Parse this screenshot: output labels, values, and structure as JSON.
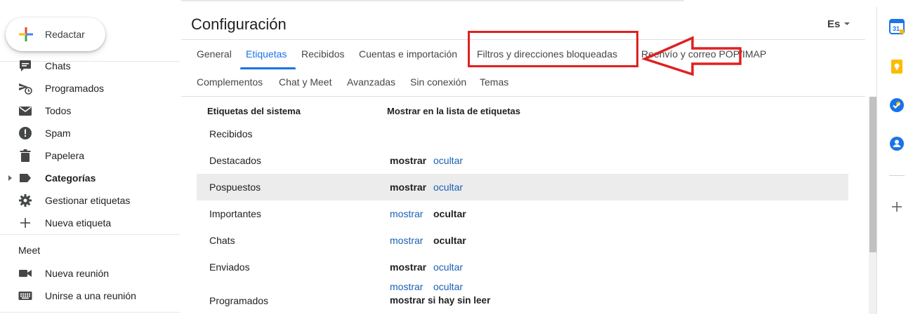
{
  "compose": {
    "label": "Redactar"
  },
  "sidebar": {
    "items": [
      {
        "label": "Chats",
        "icon": "chat-icon",
        "bold": false
      },
      {
        "label": "Programados",
        "icon": "scheduled-icon",
        "bold": false
      },
      {
        "label": "Todos",
        "icon": "all-mail-icon",
        "bold": false
      },
      {
        "label": "Spam",
        "icon": "spam-icon",
        "bold": false
      },
      {
        "label": "Papelera",
        "icon": "trash-icon",
        "bold": false
      },
      {
        "label": "Categorías",
        "icon": "label-icon",
        "bold": true
      },
      {
        "label": "Gestionar etiquetas",
        "icon": "gear-icon",
        "bold": false
      },
      {
        "label": "Nueva etiqueta",
        "icon": "plus-icon",
        "bold": false
      }
    ],
    "meet": {
      "title": "Meet",
      "items": [
        {
          "label": "Nueva reunión",
          "icon": "video-camera-icon"
        },
        {
          "label": "Unirse a una reunión",
          "icon": "keyboard-icon"
        }
      ]
    }
  },
  "header": {
    "title": "Configuración",
    "language": "Es"
  },
  "tabs": {
    "row1": [
      "General",
      "Etiquetas",
      "Recibidos",
      "Cuentas e importación",
      "Filtros y direcciones bloqueadas",
      "Reenvío y correo POP/IMAP"
    ],
    "row2": [
      "Complementos",
      "Chat y Meet",
      "Avanzadas",
      "Sin conexión",
      "Temas"
    ],
    "active": "Etiquetas"
  },
  "labels_table": {
    "col_system": "Etiquetas del sistema",
    "col_show": "Mostrar en la lista de etiquetas",
    "rows": [
      {
        "name": "Recibidos"
      },
      {
        "name": "Destacados",
        "show": "mostrar",
        "hide": "ocultar",
        "selected": "mostrar"
      },
      {
        "name": "Pospuestos",
        "show": "mostrar",
        "hide": "ocultar",
        "selected": "mostrar"
      },
      {
        "name": "Importantes",
        "show": "mostrar",
        "hide": "ocultar",
        "selected": "ocultar"
      },
      {
        "name": "Chats",
        "show": "mostrar",
        "hide": "ocultar",
        "selected": "ocultar"
      },
      {
        "name": "Enviados",
        "show": "mostrar",
        "hide": "ocultar",
        "selected": "mostrar"
      },
      {
        "name": "Programados",
        "show": "mostrar",
        "hide": "ocultar",
        "selected": "none",
        "extra": "mostrar si hay sin leer"
      }
    ]
  },
  "addons": [
    {
      "name": "Calendar",
      "icon": "calendar-icon",
      "color": "#1a73e8",
      "text": "31"
    },
    {
      "name": "Keep",
      "icon": "keep-icon",
      "color": "#fbbc04"
    },
    {
      "name": "Tasks",
      "icon": "tasks-icon",
      "color": "#1a73e8"
    },
    {
      "name": "Contacts",
      "icon": "contacts-icon",
      "color": "#1a73e8"
    }
  ],
  "annotation": {
    "color": "#e02020"
  }
}
